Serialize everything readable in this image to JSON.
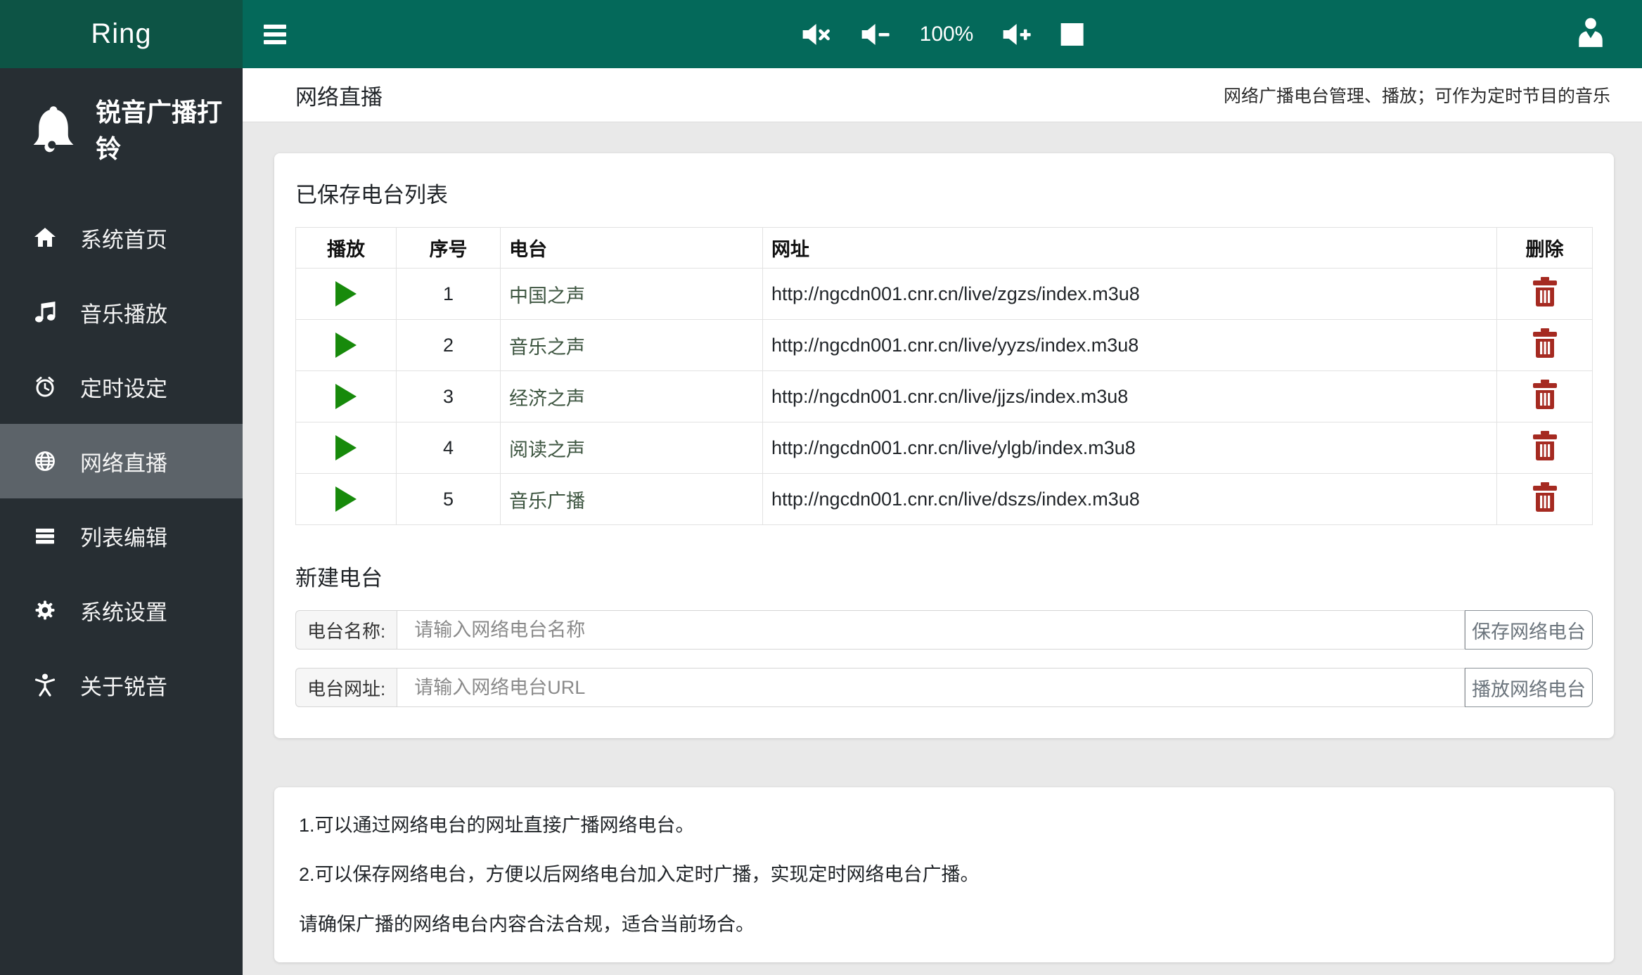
{
  "brand": {
    "logo_text": "Ring",
    "app_name": "锐音广播打铃"
  },
  "topbar": {
    "volume_level": "100%"
  },
  "sidebar": {
    "items": [
      {
        "label": "系统首页",
        "active": false
      },
      {
        "label": "音乐播放",
        "active": false
      },
      {
        "label": "定时设定",
        "active": false
      },
      {
        "label": "网络直播",
        "active": true
      },
      {
        "label": "列表编辑",
        "active": false
      },
      {
        "label": "系统设置",
        "active": false
      },
      {
        "label": "关于锐音",
        "active": false
      }
    ]
  },
  "page_header": {
    "title": "网络直播",
    "description": "网络广播电台管理、播放；可作为定时节目的音乐"
  },
  "station_list": {
    "heading": "已保存电台列表",
    "columns": {
      "play": "播放",
      "index": "序号",
      "station": "电台",
      "url": "网址",
      "delete": "删除"
    },
    "rows": [
      {
        "index": "1",
        "name": "中国之声",
        "url": "http://ngcdn001.cnr.cn/live/zgzs/index.m3u8"
      },
      {
        "index": "2",
        "name": "音乐之声",
        "url": "http://ngcdn001.cnr.cn/live/yyzs/index.m3u8"
      },
      {
        "index": "3",
        "name": "经济之声",
        "url": "http://ngcdn001.cnr.cn/live/jjzs/index.m3u8"
      },
      {
        "index": "4",
        "name": "阅读之声",
        "url": "http://ngcdn001.cnr.cn/live/ylgb/index.m3u8"
      },
      {
        "index": "5",
        "name": "音乐广播",
        "url": "http://ngcdn001.cnr.cn/live/dszs/index.m3u8"
      }
    ]
  },
  "new_station": {
    "heading": "新建电台",
    "name_label": "电台名称:",
    "name_placeholder": "请输入网络电台名称",
    "name_value": "",
    "url_label": "电台网址:",
    "url_placeholder": "请输入网络电台URL",
    "url_value": "",
    "save_button": "保存网络电台",
    "play_button": "播放网络电台"
  },
  "notes": {
    "line1": "1.可以通过网络电台的网址直接广播网络电台。",
    "line2": "2.可以保存网络电台，方便以后网络电台加入定时广播，实现定时网络电台广播。",
    "line3": "请确保广播的网络电台内容合法合规，适合当前场合。"
  },
  "colors": {
    "topbar_teal": "#04695A",
    "brand_teal": "#0D5445",
    "sidebar_dark": "#272E33",
    "sidebar_active": "#5C6369",
    "play_green": "#178A0B",
    "delete_red": "#A52A21",
    "station_name_green": "#3D5540",
    "content_bg": "#E9E9E9"
  }
}
